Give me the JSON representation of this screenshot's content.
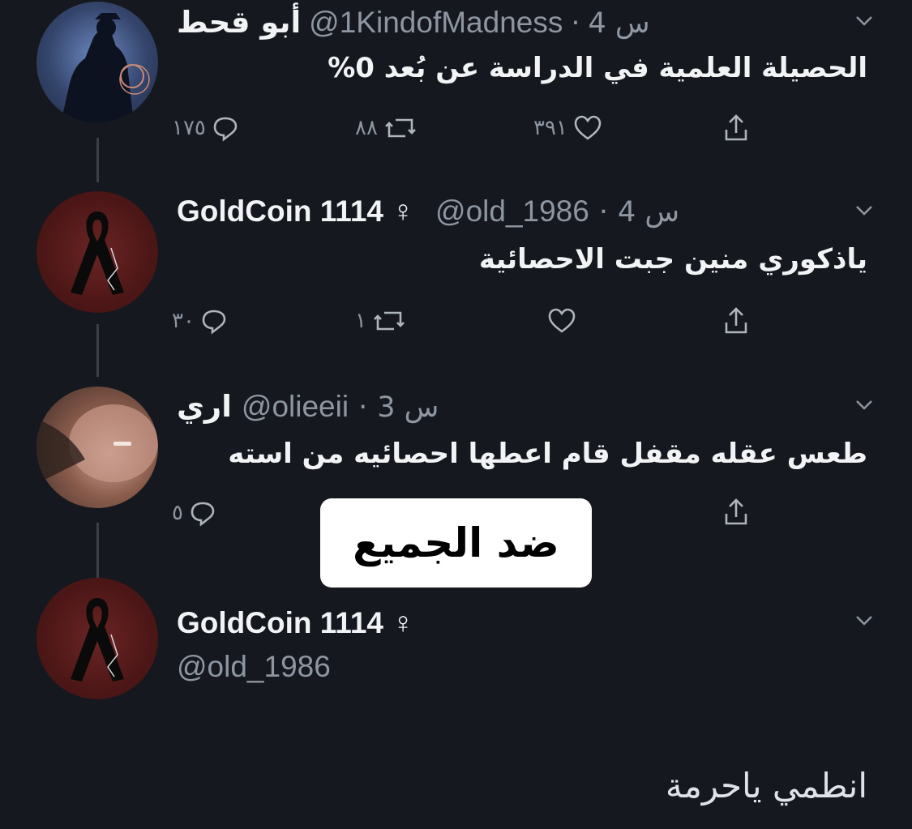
{
  "tweets": [
    {
      "name": "أبو قحط",
      "handle": "@1KindofMadness",
      "time": "4 س",
      "text": "الحصيلة العلمية في الدراسة عن بُعد 0%",
      "replies": "١٧٥",
      "retweets": "٨٨",
      "likes": "٣٩١"
    },
    {
      "name": "GoldCoin 1114 ♀",
      "handle": "@old_1986",
      "time": "4 س",
      "text": "ياذكوري منين جبت الاحصائية",
      "replies": "٣٠",
      "retweets": "١",
      "likes": ""
    },
    {
      "name": "اري",
      "handle": "@olieeii",
      "time": "3 س",
      "text": "طعس عقله مقفل قام اعطها احصائيه من استه",
      "replies": "٥"
    },
    {
      "name": "GoldCoin 1114 ♀",
      "handle": "@old_1986"
    }
  ],
  "overlay_label": "ضد الجميع",
  "reply_text": "انطمي ياحرمة",
  "colors": {
    "background": "#15181f",
    "text": "#f1f3f5",
    "muted": "#8d96a1"
  },
  "icons": [
    "chevron-down-icon",
    "reply-icon",
    "retweet-icon",
    "like-icon",
    "share-icon",
    "ribbon-icon"
  ]
}
